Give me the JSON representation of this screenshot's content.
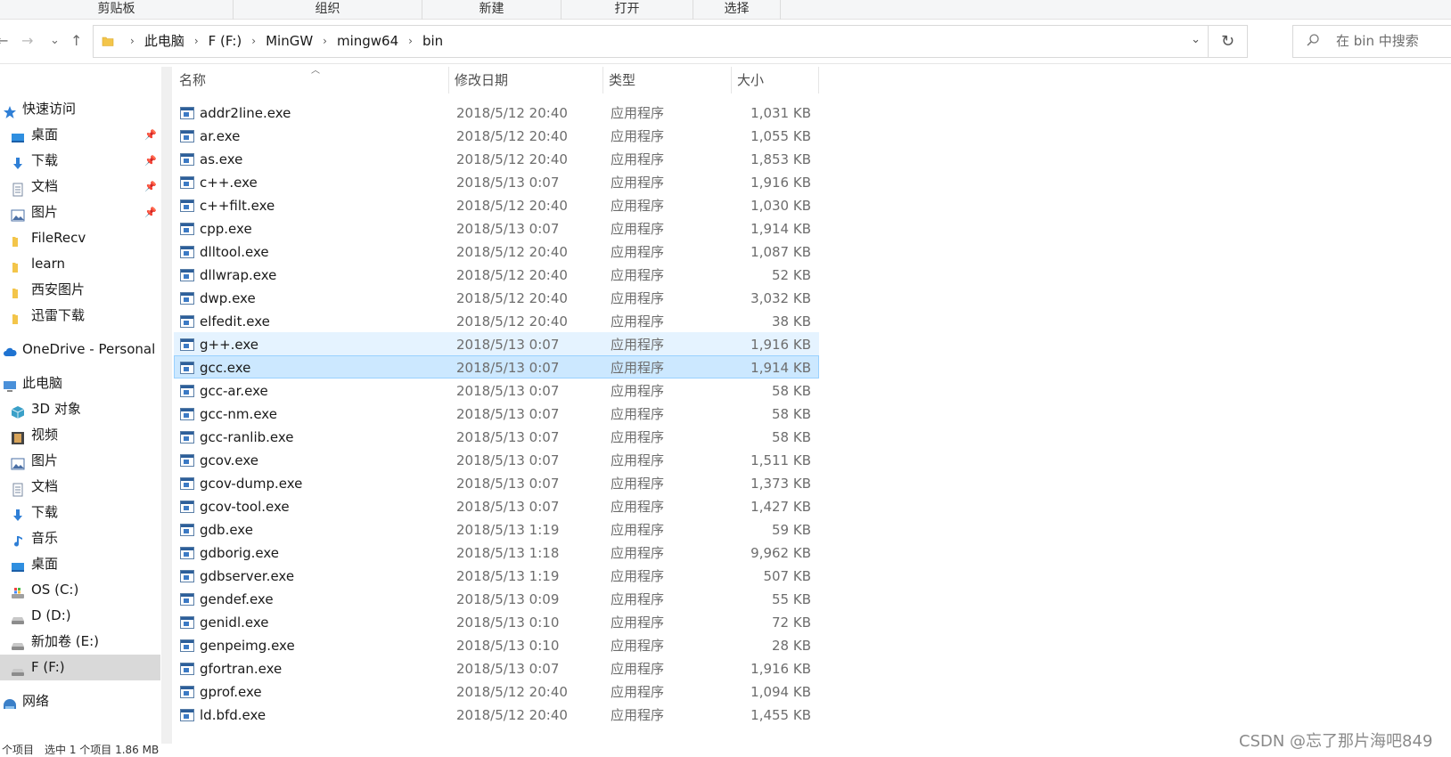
{
  "ribbon": {
    "groups": [
      "剪贴板",
      "组织",
      "新建",
      "打开",
      "选择"
    ]
  },
  "nav": {
    "back": "←",
    "forward": "→",
    "recent": "⌄",
    "up": "↑"
  },
  "address": {
    "crumbs": [
      "此电脑",
      "F (F:)",
      "MinGW",
      "mingw64",
      "bin"
    ],
    "separator": "›",
    "dropdown": "⌄",
    "refresh": "↻"
  },
  "search": {
    "placeholder": "在 bin 中搜索"
  },
  "sidebar": {
    "items": [
      {
        "label": "快速访问",
        "icon": "star-icon",
        "color": "#2f7fd6",
        "pinned": false
      },
      {
        "label": "桌面",
        "icon": "desktop-icon",
        "color": "#2f8fe0",
        "pinned": true
      },
      {
        "label": "下载",
        "icon": "download-icon",
        "color": "#2f7fd6",
        "pinned": true
      },
      {
        "label": "文档",
        "icon": "document-icon",
        "color": "#7a8aa0",
        "pinned": true
      },
      {
        "label": "图片",
        "icon": "pictures-icon",
        "color": "#4a6fa5",
        "pinned": true
      },
      {
        "label": "FileRecv",
        "icon": "folder-icon",
        "color": "#f3c54a",
        "pinned": false
      },
      {
        "label": "learn",
        "icon": "folder-icon",
        "color": "#f3c54a",
        "pinned": false
      },
      {
        "label": "西安图片",
        "icon": "folder-icon",
        "color": "#f3c54a",
        "pinned": false
      },
      {
        "label": "迅雷下载",
        "icon": "folder-icon",
        "color": "#f3c54a",
        "pinned": false
      },
      {
        "label": "OneDrive - Personal",
        "icon": "cloud-icon",
        "color": "#1f73d1",
        "pinned": false
      },
      {
        "label": "此电脑",
        "icon": "computer-icon",
        "color": "#4a90d9",
        "pinned": false
      },
      {
        "label": "3D 对象",
        "icon": "cube-icon",
        "color": "#3aa0c8",
        "pinned": false
      },
      {
        "label": "视频",
        "icon": "video-icon",
        "color": "#444",
        "pinned": false
      },
      {
        "label": "图片",
        "icon": "pictures-icon",
        "color": "#4a6fa5",
        "pinned": false
      },
      {
        "label": "文档",
        "icon": "document-icon",
        "color": "#7a8aa0",
        "pinned": false
      },
      {
        "label": "下载",
        "icon": "download-icon",
        "color": "#2f7fd6",
        "pinned": false
      },
      {
        "label": "音乐",
        "icon": "music-icon",
        "color": "#2f7fd6",
        "pinned": false
      },
      {
        "label": "桌面",
        "icon": "desktop-icon",
        "color": "#2f8fe0",
        "pinned": false
      },
      {
        "label": "OS (C:)",
        "icon": "os-drive-icon",
        "color": "#6b8fb8",
        "pinned": false
      },
      {
        "label": "D (D:)",
        "icon": "drive-icon",
        "color": "#8c8c8c",
        "pinned": false
      },
      {
        "label": "新加卷 (E:)",
        "icon": "drive-icon",
        "color": "#8c8c8c",
        "pinned": false
      },
      {
        "label": "F (F:)",
        "icon": "drive-icon",
        "color": "#8c8c8c",
        "pinned": false
      },
      {
        "label": "网络",
        "icon": "network-icon",
        "color": "#3a7fc8",
        "pinned": false
      }
    ],
    "pin_glyph": "📌"
  },
  "columns": {
    "name": "名称",
    "modified": "修改日期",
    "type": "类型",
    "size": "大小"
  },
  "files": [
    {
      "name": "addr2line.exe",
      "modified": "2018/5/12 20:40",
      "type": "应用程序",
      "size": "1,031 KB"
    },
    {
      "name": "ar.exe",
      "modified": "2018/5/12 20:40",
      "type": "应用程序",
      "size": "1,055 KB"
    },
    {
      "name": "as.exe",
      "modified": "2018/5/12 20:40",
      "type": "应用程序",
      "size": "1,853 KB"
    },
    {
      "name": "c++.exe",
      "modified": "2018/5/13 0:07",
      "type": "应用程序",
      "size": "1,916 KB"
    },
    {
      "name": "c++filt.exe",
      "modified": "2018/5/12 20:40",
      "type": "应用程序",
      "size": "1,030 KB"
    },
    {
      "name": "cpp.exe",
      "modified": "2018/5/13 0:07",
      "type": "应用程序",
      "size": "1,914 KB"
    },
    {
      "name": "dlltool.exe",
      "modified": "2018/5/12 20:40",
      "type": "应用程序",
      "size": "1,087 KB"
    },
    {
      "name": "dllwrap.exe",
      "modified": "2018/5/12 20:40",
      "type": "应用程序",
      "size": "52 KB"
    },
    {
      "name": "dwp.exe",
      "modified": "2018/5/12 20:40",
      "type": "应用程序",
      "size": "3,032 KB"
    },
    {
      "name": "elfedit.exe",
      "modified": "2018/5/12 20:40",
      "type": "应用程序",
      "size": "38 KB"
    },
    {
      "name": "g++.exe",
      "modified": "2018/5/13 0:07",
      "type": "应用程序",
      "size": "1,916 KB",
      "state": "hover"
    },
    {
      "name": "gcc.exe",
      "modified": "2018/5/13 0:07",
      "type": "应用程序",
      "size": "1,914 KB",
      "state": "selected"
    },
    {
      "name": "gcc-ar.exe",
      "modified": "2018/5/13 0:07",
      "type": "应用程序",
      "size": "58 KB"
    },
    {
      "name": "gcc-nm.exe",
      "modified": "2018/5/13 0:07",
      "type": "应用程序",
      "size": "58 KB"
    },
    {
      "name": "gcc-ranlib.exe",
      "modified": "2018/5/13 0:07",
      "type": "应用程序",
      "size": "58 KB"
    },
    {
      "name": "gcov.exe",
      "modified": "2018/5/13 0:07",
      "type": "应用程序",
      "size": "1,511 KB"
    },
    {
      "name": "gcov-dump.exe",
      "modified": "2018/5/13 0:07",
      "type": "应用程序",
      "size": "1,373 KB"
    },
    {
      "name": "gcov-tool.exe",
      "modified": "2018/5/13 0:07",
      "type": "应用程序",
      "size": "1,427 KB"
    },
    {
      "name": "gdb.exe",
      "modified": "2018/5/13 1:19",
      "type": "应用程序",
      "size": "59 KB"
    },
    {
      "name": "gdborig.exe",
      "modified": "2018/5/13 1:18",
      "type": "应用程序",
      "size": "9,962 KB"
    },
    {
      "name": "gdbserver.exe",
      "modified": "2018/5/13 1:19",
      "type": "应用程序",
      "size": "507 KB"
    },
    {
      "name": "gendef.exe",
      "modified": "2018/5/13 0:09",
      "type": "应用程序",
      "size": "55 KB"
    },
    {
      "name": "genidl.exe",
      "modified": "2018/5/13 0:10",
      "type": "应用程序",
      "size": "72 KB"
    },
    {
      "name": "genpeimg.exe",
      "modified": "2018/5/13 0:10",
      "type": "应用程序",
      "size": "28 KB"
    },
    {
      "name": "gfortran.exe",
      "modified": "2018/5/13 0:07",
      "type": "应用程序",
      "size": "1,916 KB"
    },
    {
      "name": "gprof.exe",
      "modified": "2018/5/12 20:40",
      "type": "应用程序",
      "size": "1,094 KB"
    },
    {
      "name": "ld.bfd.exe",
      "modified": "2018/5/12 20:40",
      "type": "应用程序",
      "size": "1,455 KB"
    }
  ],
  "status": {
    "text": "个项目　选中 1 个项目 1.86 MB"
  },
  "watermark": "CSDN @忘了那片海吧849"
}
